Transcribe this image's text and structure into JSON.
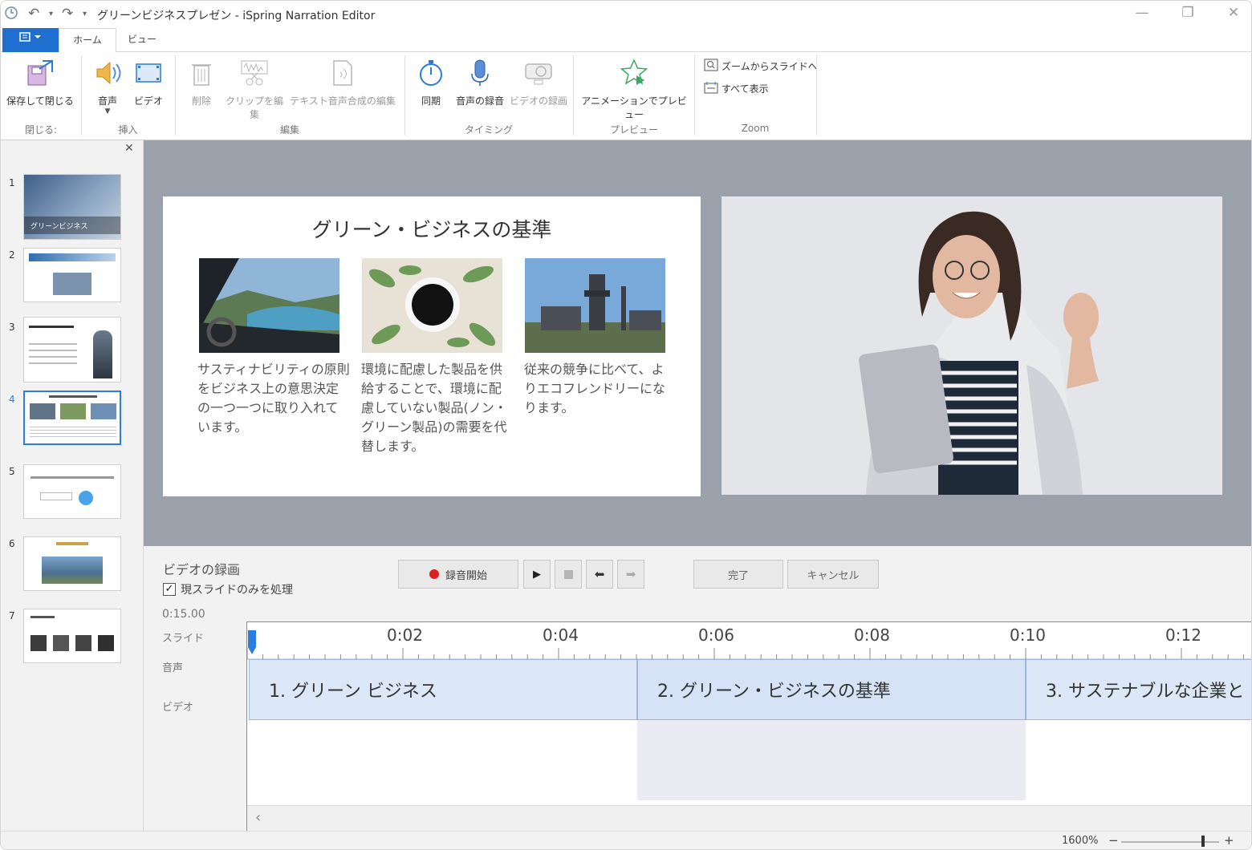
{
  "window": {
    "title": "グリーンビジネスプレゼン - iSpring Narration Editor"
  },
  "tabs": [
    {
      "label": "ホーム"
    },
    {
      "label": "ビュー"
    }
  ],
  "ribbon": {
    "close_group": {
      "save_close": "保存して閉じる",
      "label": "閉じる:"
    },
    "insert_group": {
      "audio": "音声",
      "video": "ビデオ",
      "label": "挿入"
    },
    "edit_group": {
      "delete": "削除",
      "edit_clip": "クリップを編集",
      "tts_edit": "テキスト音声合成の編集",
      "label": "編集"
    },
    "timing_group": {
      "sync": "同期",
      "record_audio": "音声の録音",
      "record_video": "ビデオの録画",
      "label": "タイミング"
    },
    "preview_group": {
      "preview_anim": "アニメーションでプレビュー",
      "label": "プレビュー"
    },
    "zoom_group": {
      "zoom_to_slide": "ズームからスライドへ",
      "show_all": "すべて表示",
      "label": "Zoom"
    }
  },
  "thumbnails": {
    "items": [
      {
        "num": "1",
        "caption": "グリーンビジネス"
      },
      {
        "num": "2"
      },
      {
        "num": "3"
      },
      {
        "num": "4"
      },
      {
        "num": "5"
      },
      {
        "num": "6"
      },
      {
        "num": "7"
      }
    ],
    "selected": 4
  },
  "slide": {
    "title": "グリーン・ビジネスの基準",
    "captions": [
      "サスティナビリティの原則をビジネス上の意思決定の一つ一つに取り入れています。",
      "環境に配慮した製品を供給することで、環境に配慮していない製品(ノン・グリーン製品)の需要を代替します。",
      "従来の競争に比べて、よりエコフレンドリーになります。"
    ]
  },
  "recording": {
    "heading": "ビデオの録画",
    "checkbox_label": "現スライドのみを処理",
    "checkbox_checked": true,
    "start_button": "録音開始",
    "done_button": "完了",
    "cancel_button": "キャンセル",
    "duration": "0:15.00",
    "track_labels": {
      "slide": "スライド",
      "audio": "音声",
      "video": "ビデオ"
    }
  },
  "timeline": {
    "ticks": [
      "0:02",
      "0:04",
      "0:06",
      "0:08",
      "0:10",
      "0:12"
    ],
    "segments": [
      {
        "label": "1. グリーン ビジネス"
      },
      {
        "label": "2. グリーン・ビジネスの基準"
      },
      {
        "label": "3. サステナブルな企業と"
      }
    ]
  },
  "statusbar": {
    "zoom": "1600%"
  },
  "colors": {
    "accent": "#1f6fd1",
    "stage_bg": "#9aa1ab",
    "segment_fill": "#dce8f8",
    "record_dot": "#e02020"
  }
}
